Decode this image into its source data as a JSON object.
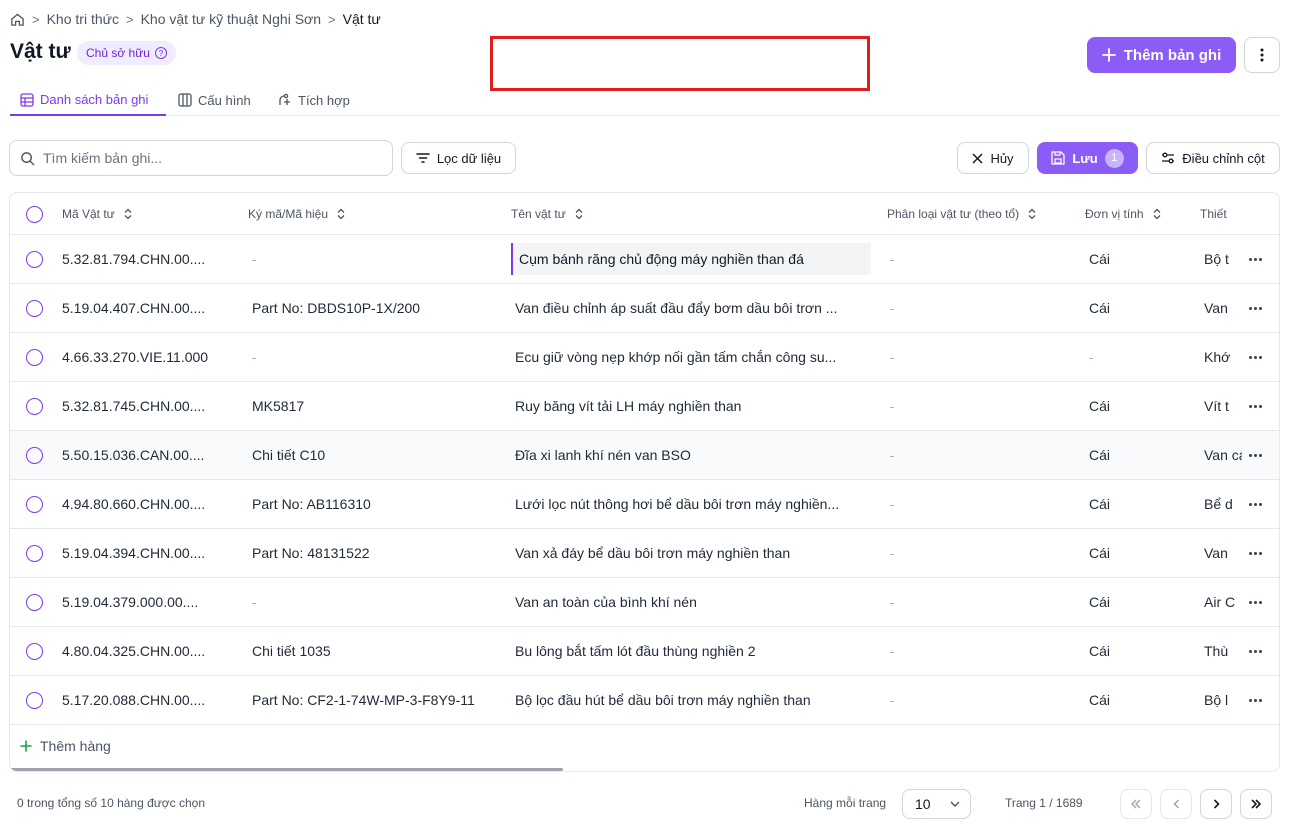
{
  "breadcrumb": {
    "home_icon": "home-icon",
    "items": [
      "Kho tri thức",
      "Kho vật tư kỹ thuật Nghi Sơn",
      "Vật tư"
    ]
  },
  "page": {
    "title": "Vật tư",
    "owner_badge": "Chủ sở hữu",
    "add_record_label": "Thêm bản ghi"
  },
  "tabs": [
    {
      "label": "Danh sách bản ghi",
      "icon": "table-icon",
      "active": true
    },
    {
      "label": "Cấu hình",
      "icon": "columns-icon",
      "active": false
    },
    {
      "label": "Tích hợp",
      "icon": "integration-icon",
      "active": false
    }
  ],
  "toolbar": {
    "search_placeholder": "Tìm kiếm bản ghi...",
    "filter_label": "Lọc dữ liệu",
    "cancel_label": "Hủy",
    "save_label": "Lưu",
    "save_count": "1",
    "adjust_columns_label": "Điều chỉnh cột"
  },
  "table": {
    "columns": [
      "Mã Vật tư",
      "Ký mã/Mã hiệu",
      "Tên vật tư",
      "Phân loại vật tư (theo tổ)",
      "Đơn vị tính",
      "Thiết"
    ],
    "rows": [
      {
        "code": "5.32.81.794.CHN.00....",
        "symbol": "-",
        "name": "Cụm bánh răng chủ động máy nghiền than đá",
        "category": "-",
        "unit": "Cái",
        "device": "Bộ t"
      },
      {
        "code": "5.19.04.407.CHN.00....",
        "symbol": "Part No: DBDS10P-1X/200",
        "name": "Van điều chỉnh áp suất đầu đẩy bơm dầu bôi trơn ...",
        "category": "-",
        "unit": "Cái",
        "device": "Van"
      },
      {
        "code": "4.66.33.270.VIE.11.000",
        "symbol": "-",
        "name": "Ecu giữ vòng nẹp khớp nối gần tấm chắn công su...",
        "category": "-",
        "unit": "-",
        "device": "Khớ"
      },
      {
        "code": "5.32.81.745.CHN.00....",
        "symbol": "MK5817",
        "name": "Ruy băng vít tải LH máy nghiền than",
        "category": "-",
        "unit": "Cái",
        "device": "Vít t"
      },
      {
        "code": "5.50.15.036.CAN.00....",
        "symbol": "Chi tiết C10",
        "name": "Đĩa xi lanh khí nén van BSO",
        "category": "-",
        "unit": "Cái",
        "device": "Van cách ly"
      },
      {
        "code": "4.94.80.660.CHN.00....",
        "symbol": "Part No: AB116310",
        "name": "Lưới lọc nút thông hơi bể dầu bôi trơn máy nghiền...",
        "category": "-",
        "unit": "Cái",
        "device": "Bể d"
      },
      {
        "code": "5.19.04.394.CHN.00....",
        "symbol": "Part No: 48131522",
        "name": "Van xả đáy bể dầu bôi trơn máy nghiền than",
        "category": "-",
        "unit": "Cái",
        "device": "Van"
      },
      {
        "code": "5.19.04.379.000.00....",
        "symbol": "-",
        "name": "Van an toàn của bình khí nén",
        "category": "-",
        "unit": "Cái",
        "device": "Air C"
      },
      {
        "code": "4.80.04.325.CHN.00....",
        "symbol": "Chi tiết 1035",
        "name": "Bu lông bắt tấm lót đầu thùng nghiền 2",
        "category": "-",
        "unit": "Cái",
        "device": "Thù"
      },
      {
        "code": "5.17.20.088.CHN.00....",
        "symbol": "Part No: CF2-1-74W-MP-3-F8Y9-11",
        "name": "Bộ lọc đầu hút bể dầu bôi trơn máy nghiền than",
        "category": "-",
        "unit": "Cái",
        "device": "Bộ l"
      }
    ],
    "add_row_label": "Thêm hàng"
  },
  "footer": {
    "selection_text": "0 trong tổng số 10 hàng được chọn",
    "rows_per_page_label": "Hàng mỗi trang",
    "rows_per_page_value": "10",
    "page_info": "Trang 1 / 1689"
  },
  "colors": {
    "accent": "#8b5cf6",
    "accent_dark": "#7c3aed",
    "highlight": "#e11d1d"
  }
}
